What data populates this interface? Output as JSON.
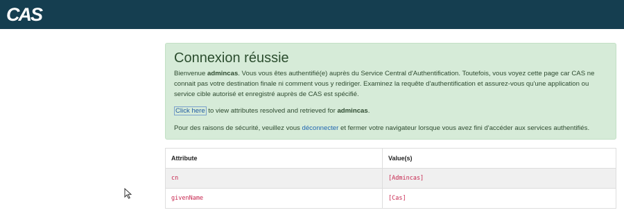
{
  "header": {
    "logo": "CAS"
  },
  "alert": {
    "title": "Connexion réussie",
    "intro_prefix": "Bienvenue ",
    "username": "admincas",
    "intro_suffix": ". Vous vous êtes authentifié(e) auprès du Service Central d'Authentification. Toutefois, vous voyez cette page car CAS ne connait pas votre destination finale ni comment vous y rediriger. Examinez la requête d'authentification et assurez-vous qu'une application ou service cible autorisé et enregistré auprès de CAS est spécifié.",
    "click_here": "Click here",
    "attr_text": " to view attributes resolved and retrieved for ",
    "attr_user": "admincas",
    "attr_end": ".",
    "security_prefix": "Pour des raisons de sécurité, veuillez vous ",
    "logout_link": "déconnecter",
    "security_suffix": " et fermer votre navigateur lorsque vous avez fini d'accéder aux services authentifiés."
  },
  "table": {
    "headers": [
      "Attribute",
      "Value(s)"
    ],
    "rows": [
      [
        "cn",
        "[Admincas]"
      ],
      [
        "givenName",
        "[Cas]"
      ]
    ]
  }
}
